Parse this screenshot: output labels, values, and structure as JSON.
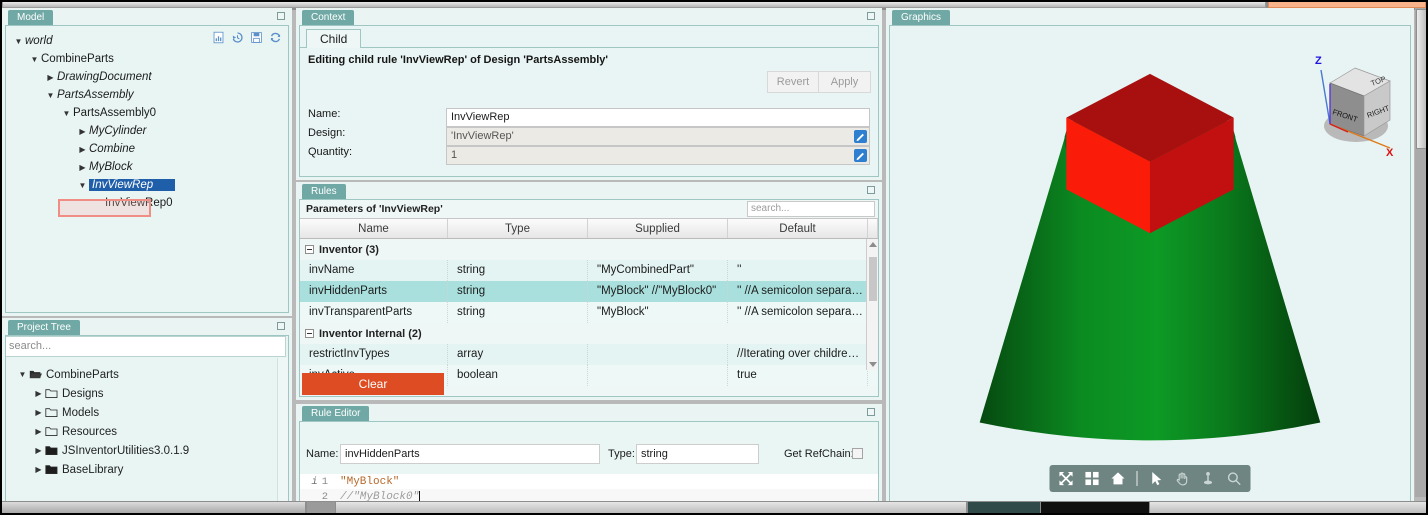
{
  "model_panel": {
    "tab_label": "Model",
    "toolbar_icons": [
      "report-icon",
      "history-icon",
      "save-icon",
      "refresh-icon"
    ],
    "tree": [
      {
        "label": "world",
        "depth": 0,
        "arrow": "down",
        "italic": true,
        "selected": false
      },
      {
        "label": "CombineParts",
        "depth": 1,
        "arrow": "down",
        "italic": false,
        "selected": false
      },
      {
        "label": "DrawingDocument",
        "depth": 2,
        "arrow": "right",
        "italic": true,
        "selected": false
      },
      {
        "label": "PartsAssembly",
        "depth": 2,
        "arrow": "down",
        "italic": true,
        "selected": false
      },
      {
        "label": "PartsAssembly0",
        "depth": 3,
        "arrow": "down",
        "italic": false,
        "selected": false
      },
      {
        "label": "MyCylinder",
        "depth": 4,
        "arrow": "right",
        "italic": true,
        "selected": false
      },
      {
        "label": "Combine",
        "depth": 4,
        "arrow": "right",
        "italic": true,
        "selected": false
      },
      {
        "label": "MyBlock",
        "depth": 4,
        "arrow": "right",
        "italic": true,
        "selected": false
      },
      {
        "label": "InvViewRep",
        "depth": 4,
        "arrow": "down",
        "italic": true,
        "selected": true
      },
      {
        "label": "InvViewRep0",
        "depth": 5,
        "arrow": "none",
        "italic": false,
        "selected": false
      }
    ]
  },
  "project_tree_panel": {
    "tab_label": "Project Tree",
    "search_placeholder": "search...",
    "nodes": [
      {
        "label": "CombineParts",
        "depth": 0,
        "arrow": "down",
        "icon": "folder-open-icon"
      },
      {
        "label": "Designs",
        "depth": 1,
        "arrow": "right",
        "icon": "folder-icon"
      },
      {
        "label": "Models",
        "depth": 1,
        "arrow": "right",
        "icon": "folder-icon"
      },
      {
        "label": "Resources",
        "depth": 1,
        "arrow": "right",
        "icon": "folder-icon"
      },
      {
        "label": "JSInventorUtilities3.0.1.9",
        "depth": 1,
        "arrow": "right",
        "icon": "folder-solid-icon"
      },
      {
        "label": "BaseLibrary",
        "depth": 1,
        "arrow": "right",
        "icon": "folder-solid-icon"
      }
    ]
  },
  "context_panel": {
    "tab_label": "Context",
    "sub_tab": "Child",
    "heading": "Editing child rule 'InvViewRep' of Design 'PartsAssembly'",
    "revert_label": "Revert",
    "apply_label": "Apply",
    "fields": [
      {
        "label": "Name:",
        "value": "InvViewRep",
        "readonly": false,
        "pencil": false
      },
      {
        "label": "Design:",
        "value": "'InvViewRep'",
        "readonly": true,
        "pencil": true
      },
      {
        "label": "Quantity:",
        "value": "1",
        "readonly": true,
        "pencil": true
      }
    ]
  },
  "rules_panel": {
    "tab_label": "Rules",
    "params_label": "Parameters of 'InvViewRep'",
    "search_placeholder": "search...",
    "columns": [
      "Name",
      "Type",
      "Supplied",
      "Default"
    ],
    "rows": [
      {
        "kind": "group",
        "name": "Inventor (3)"
      },
      {
        "kind": "row",
        "name": "invName",
        "type": "string",
        "supplied": "\"MyCombinedPart\"",
        "default": "''",
        "highlight": false
      },
      {
        "kind": "row",
        "name": "invHiddenParts",
        "type": "string",
        "supplied": "\"MyBlock\" //\"MyBlock0\"",
        "default": "'' //A semicolon separa…",
        "highlight": true
      },
      {
        "kind": "row",
        "name": "invTransparentParts",
        "type": "string",
        "supplied": "\"MyBlock\"",
        "default": "'' //A semicolon separa…",
        "highlight": false
      },
      {
        "kind": "group",
        "name": "Inventor Internal (2)"
      },
      {
        "kind": "row",
        "name": "restrictInvTypes",
        "type": "array",
        "supplied": "",
        "default": "//Iterating over childre…",
        "highlight": false
      },
      {
        "kind": "row",
        "name": "invActive",
        "type": "boolean",
        "supplied": "",
        "default": "true",
        "highlight": false
      }
    ],
    "clear_label": "Clear",
    "clear_color": "#dd4c22"
  },
  "rule_editor_panel": {
    "tab_label": "Rule Editor",
    "name_label": "Name:",
    "name_value": "invHiddenParts",
    "type_label": "Type:",
    "type_value": "string",
    "refchain_label": "Get RefChain:",
    "refchain_checked": false,
    "code_lines": [
      {
        "number": "1",
        "gutter_icon": "i",
        "text": "\"MyBlock\"",
        "style": "string"
      },
      {
        "number": "2",
        "gutter_icon": "",
        "text": "//\"MyBlock0\"",
        "style": "comment"
      }
    ]
  },
  "graphics_panel": {
    "tab_label": "Graphics",
    "background": "#e7f4f3",
    "scene": {
      "cone_color": "#0c7a1e",
      "cone_color_dark": "#05500f",
      "cube_color_top": "#a81010",
      "cube_color_left": "#fa1b09",
      "cube_color_right": "#c21010"
    },
    "viewcube": {
      "faces": [
        "TOP",
        "FRONT",
        "RIGHT"
      ],
      "axes": [
        {
          "label": "Z",
          "color": "#1f12e0"
        },
        {
          "label": "X",
          "color": "#e01010"
        }
      ]
    },
    "toolbar_icons": [
      "fit-to-view-icon",
      "grid-view-icon",
      "home-icon",
      "separator",
      "select-arrow-icon",
      "pan-hand-icon",
      "orbit-icon",
      "zoom-magnifier-icon"
    ]
  }
}
